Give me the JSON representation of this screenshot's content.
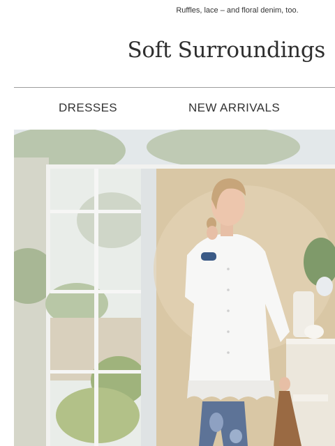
{
  "preheader": {
    "text": "Ruffles, lace – and floral denim, too."
  },
  "brand": {
    "logo_text": "Soft Surroundings"
  },
  "nav": {
    "items": [
      {
        "label": "DRESSES"
      },
      {
        "label": "NEW ARRIVALS"
      }
    ]
  },
  "hero": {
    "subject": "woman-in-white-lace-trim-tunic-and-floral-denim"
  },
  "colors": {
    "text": "#333333",
    "divider": "#9c9c9c",
    "background": "#ffffff"
  }
}
